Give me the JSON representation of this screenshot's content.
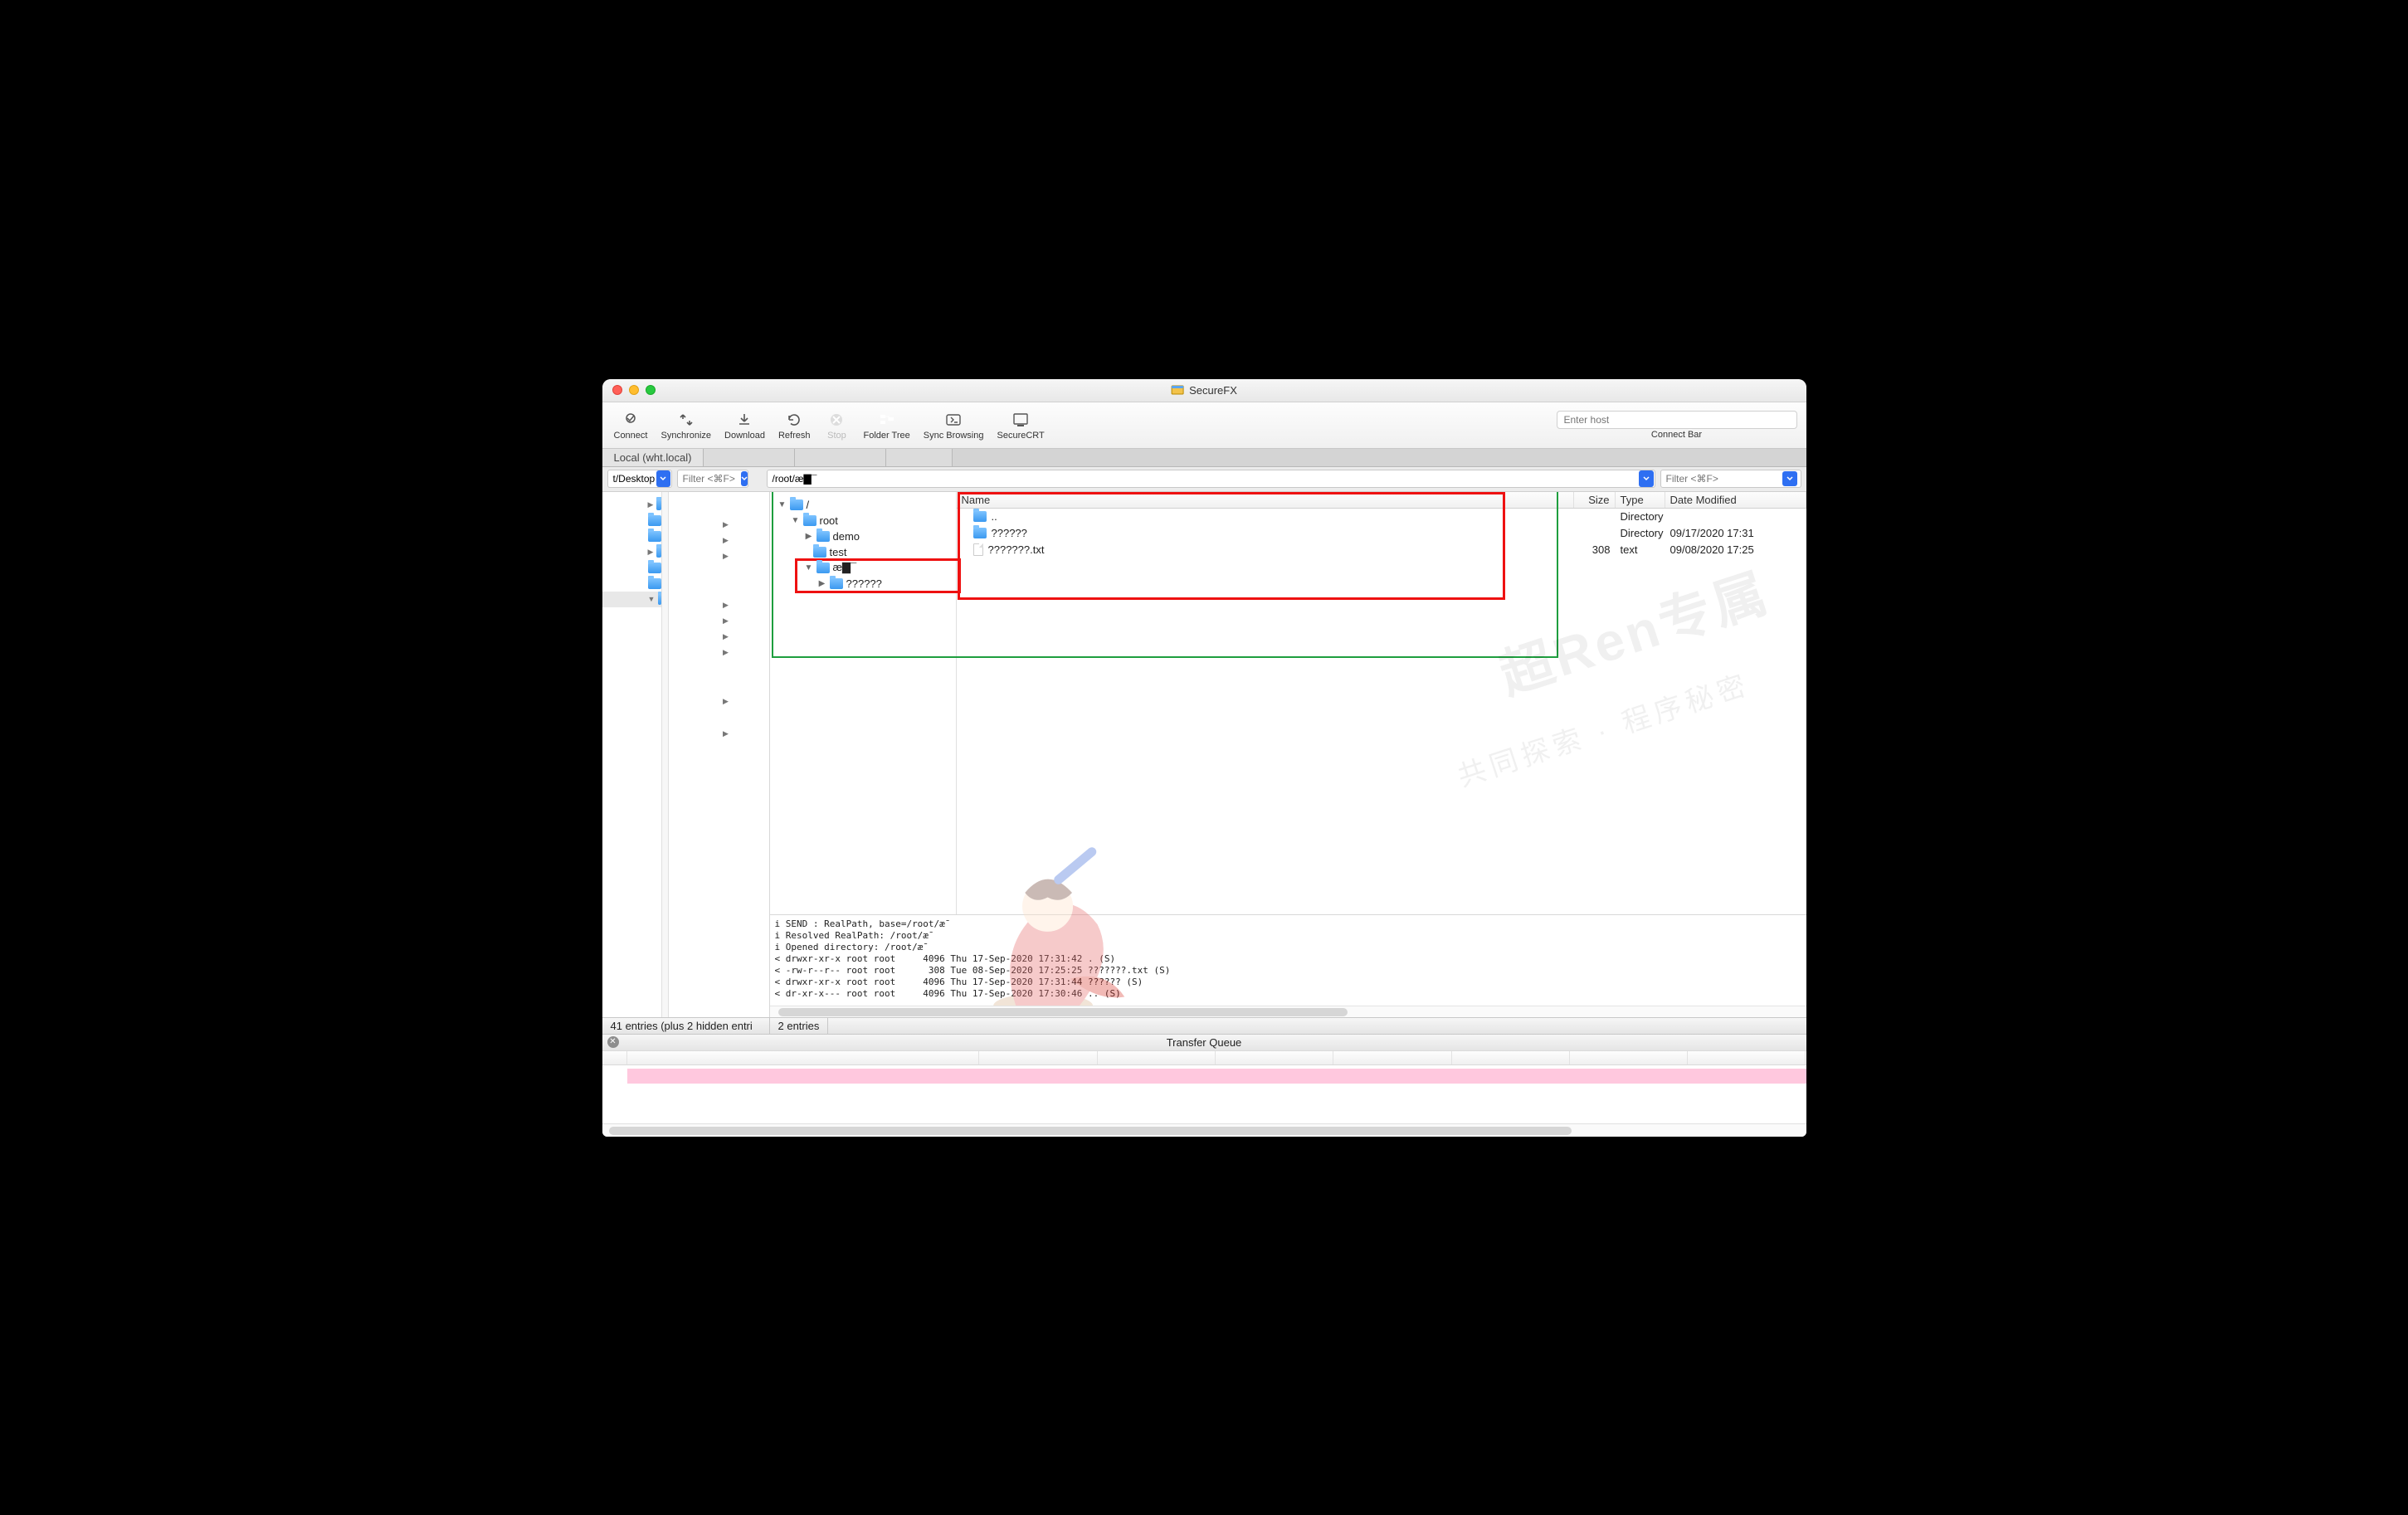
{
  "window": {
    "title": "SecureFX"
  },
  "toolbar": {
    "connect": "Connect",
    "synchronize": "Synchronize",
    "download": "Download",
    "refresh": "Refresh",
    "stop": "Stop",
    "folder_tree": "Folder Tree",
    "sync_browsing": "Sync Browsing",
    "securecrt": "SecureCRT"
  },
  "connect_bar": {
    "placeholder": "Enter host",
    "label": "Connect Bar"
  },
  "tabs": {
    "local": "Local (wht.local)"
  },
  "left": {
    "path": "t/Desktop",
    "filter_ph": "Filter <⌘F>"
  },
  "right": {
    "path": "/root/æ▇¯",
    "filter_ph": "Filter <⌘F>"
  },
  "rtree": {
    "root": "/",
    "items": [
      {
        "name": "root",
        "expanded": true,
        "depth": 1
      },
      {
        "name": "demo",
        "expanded": false,
        "depth": 2
      },
      {
        "name": "test",
        "depth": 2
      },
      {
        "name": "æ▇¯",
        "expanded": true,
        "depth": 2
      },
      {
        "name": "??????",
        "expanded": false,
        "depth": 3
      }
    ]
  },
  "rcols": {
    "name": "Name",
    "size": "Size",
    "type": "Type",
    "date": "Date Modified"
  },
  "rrows": [
    {
      "name": "..",
      "size": "",
      "type": "Directory",
      "date": "",
      "icon": "folder"
    },
    {
      "name": "??????",
      "size": "",
      "type": "Directory",
      "date": "09/17/2020 17:31",
      "icon": "folder"
    },
    {
      "name": "???????.txt",
      "size": "308",
      "type": "text",
      "date": "09/08/2020 17:25",
      "icon": "file"
    }
  ],
  "log_lines": [
    "i SEND : RealPath, base=/root/æ¯",
    "i Resolved RealPath: /root/æ¯",
    "i Opened directory: /root/æ¯",
    "< drwxr-xr-x root root     4096 Thu 17-Sep-2020 17:31:42 . (S)",
    "< -rw-r--r-- root root      308 Tue 08-Sep-2020 17:25:25 ???????.txt (S)",
    "< drwxr-xr-x root root     4096 Thu 17-Sep-2020 17:31:44 ?????? (S)",
    "< dr-xr-x--- root root     4096 Thu 17-Sep-2020 17:30:46 .. (S)"
  ],
  "status": {
    "left": "41 entries (plus 2 hidden entri",
    "right": "2 entries"
  },
  "transfer_queue": {
    "title": "Transfer Queue"
  },
  "watermark": {
    "big": "超Ren专属",
    "small": "共同探索 · 程序秘密"
  }
}
